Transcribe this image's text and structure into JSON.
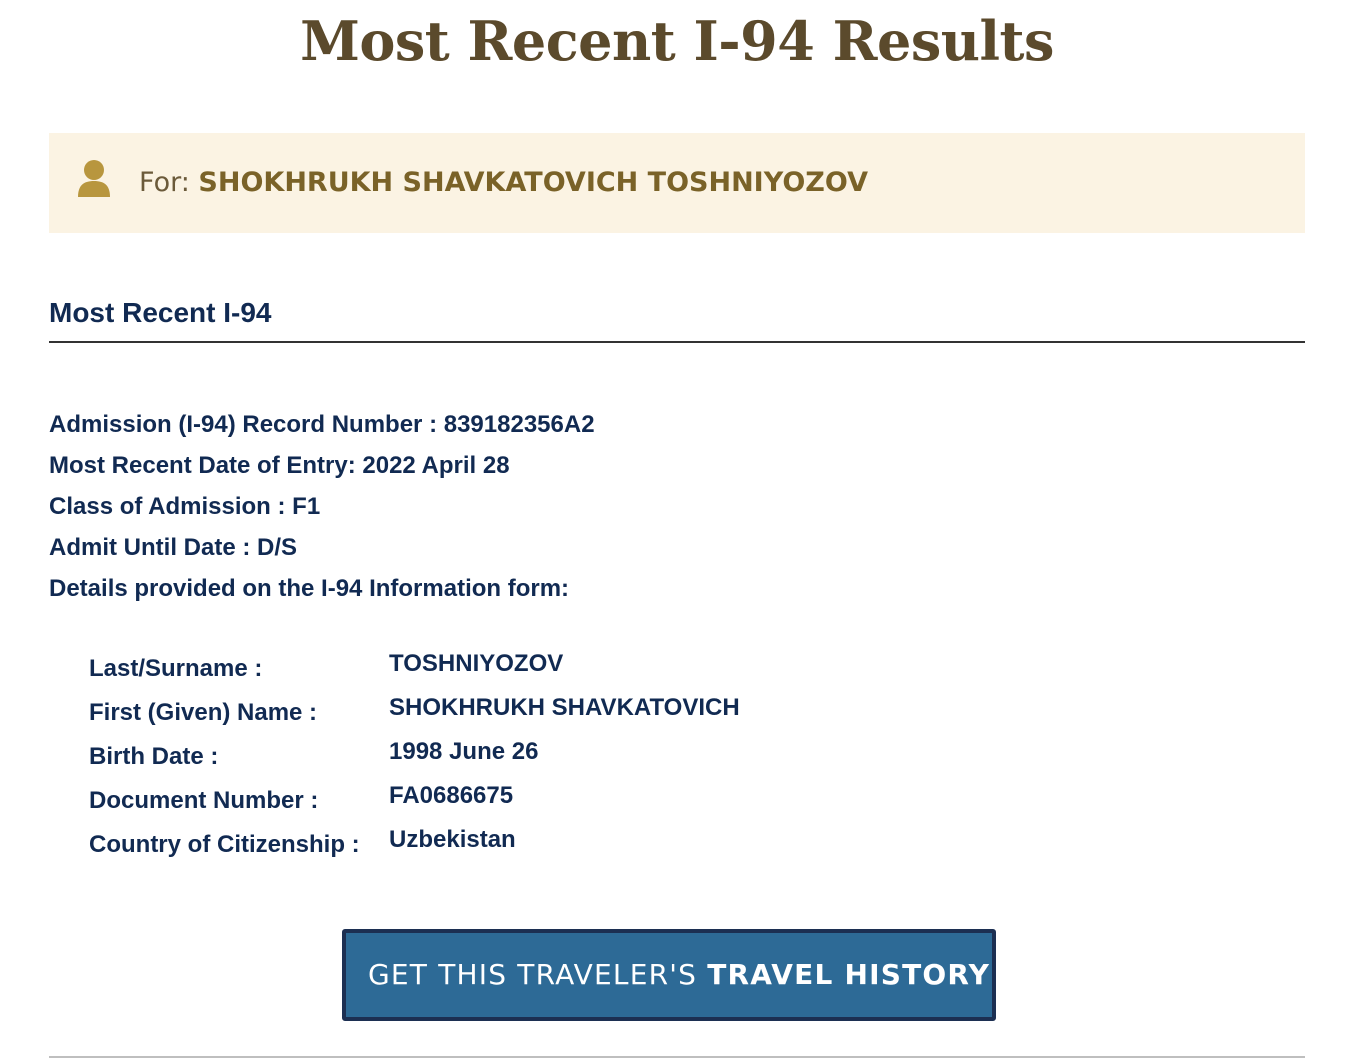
{
  "page": {
    "title": "Most Recent I-94 Results"
  },
  "banner": {
    "prefix": "For:",
    "name": "SHOKHRUKH SHAVKATOVICH TOSHNIYOZOV",
    "icon": "user-icon"
  },
  "section": {
    "heading": "Most Recent I-94"
  },
  "details": [
    {
      "label": "Admission (I-94) Record Number :",
      "value": "839182356A2"
    },
    {
      "label": "Most Recent Date of Entry:",
      "value": "2022 April 28"
    },
    {
      "label": "Class of Admission :",
      "value": "F1"
    },
    {
      "label": "Admit Until Date :",
      "value": "D/S"
    },
    {
      "label": "Details provided on the I-94 Information form:",
      "value": ""
    }
  ],
  "traveler": [
    {
      "label": "Last/Surname :",
      "value": "TOSHNIYOZOV"
    },
    {
      "label": "First (Given) Name :",
      "value": "SHOKHRUKH SHAVKATOVICH"
    },
    {
      "label": "Birth Date :",
      "value": "1998 June 26"
    },
    {
      "label": "Document Number :",
      "value": "FA0686675"
    },
    {
      "label": "Country of Citizenship :",
      "value": "Uzbekistan"
    }
  ],
  "button": {
    "prefix": "GET THIS TRAVELER'S",
    "strong": "TRAVEL HISTORY"
  },
  "colors": {
    "title": "#5b4a2c",
    "banner_bg": "#fbf3e3",
    "icon": "#b8963e",
    "text_navy": "#112a52",
    "button_bg": "#2d6a96",
    "button_border": "#1c2f52"
  }
}
